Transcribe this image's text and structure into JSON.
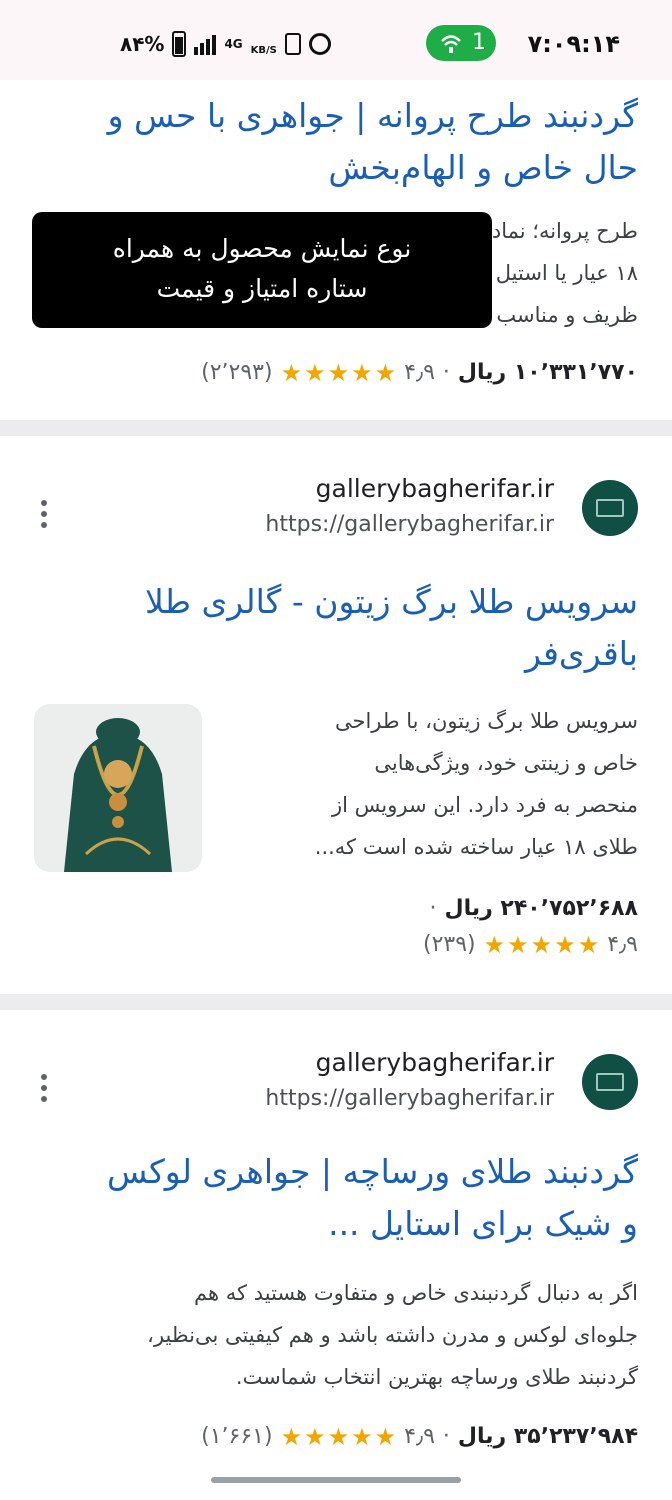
{
  "status_bar": {
    "time": "۷:۰۹:۱۴",
    "active_count": "1",
    "battery": "۸۴%",
    "network": "4G",
    "speed_unit": "KB/S"
  },
  "tooltip": {
    "line1": "نوع نمایش محصول به همراه",
    "line2": "ستاره امتیاز و قیمت"
  },
  "results": [
    {
      "title_line1": "گردنبند طرح پروانه | جواهری با حس و",
      "title_line2": "حال خاص و الهام‌بخش",
      "snippet_lines": [
        "طرح پروانه؛ نماد",
        "۱۸ عیار یا استیل",
        "ظریف و مناسب"
      ],
      "price": "۱۰٬۳۳۱٬۷۷۰ ریال",
      "rating": "۴٫۹",
      "review_count": "(۲٬۲۹۳)"
    },
    {
      "site_name": "gallerybagherifar.ir",
      "site_url": "https://gallerybagherifar.ir",
      "title_line1": "سرویس طلا برگ زیتون - گالری طلا",
      "title_line2": "باقری‌فر",
      "snippet_lines": [
        "سرویس طلا برگ زیتون، با طراحی",
        "خاص و زینتی خود، ویژگی‌هایی",
        "منحصر به فرد دارد. این سرویس از",
        "طلای ۱۸ عیار ساخته شده است که..."
      ],
      "price": "۲۴۰٬۷۵۲٬۶۸۸ ریال",
      "rating": "۴٫۹",
      "review_count": "(۲۳۹)"
    },
    {
      "site_name": "gallerybagherifar.ir",
      "site_url": "https://gallerybagherifar.ir",
      "title_line1": "گردنبند طلای ورساچه | جواهری لوکس",
      "title_line2": "و شیک برای استایل ...",
      "snippet_lines": [
        "اگر به دنبال گردنبندی خاص و متفاوت هستید که هم",
        "جلوه‌ای لوکس و مدرن داشته باشد و هم کیفیتی بی‌نظیر،",
        "گردنبند طلای ورساچه بهترین انتخاب شماست."
      ],
      "price": "۳۵٬۲۳۷٬۹۸۴ ریال",
      "rating": "۴٫۹",
      "review_count": "(۱٬۶۶۱)"
    }
  ],
  "colors": {
    "title": "#1a5fb4",
    "star": "#f2a600",
    "status_pill": "#1fad47"
  }
}
